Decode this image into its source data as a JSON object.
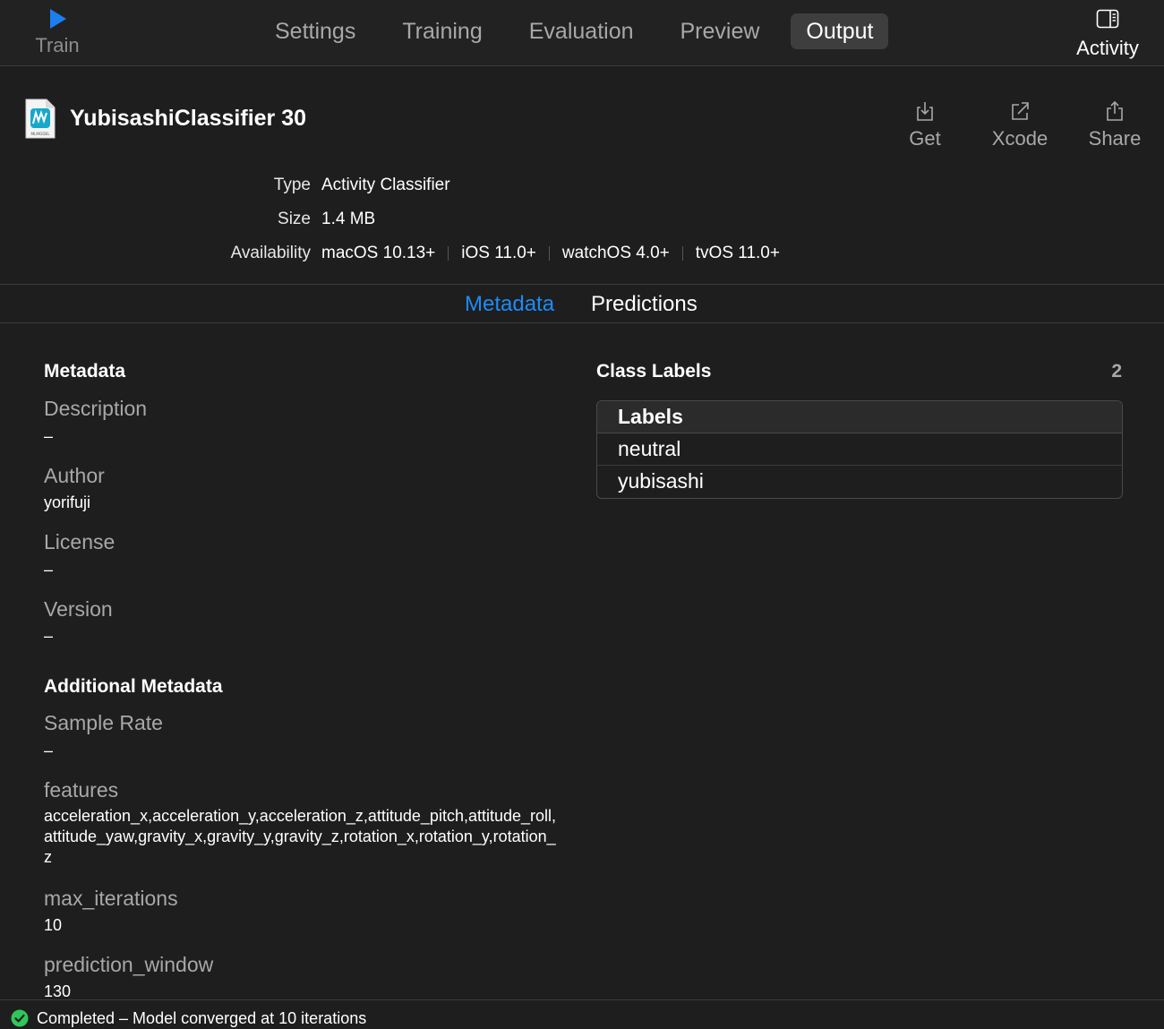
{
  "toolbar": {
    "train_label": "Train",
    "tabs": [
      {
        "label": "Settings"
      },
      {
        "label": "Training"
      },
      {
        "label": "Evaluation"
      },
      {
        "label": "Preview"
      },
      {
        "label": "Output"
      }
    ],
    "active_tab": "Output",
    "activity_label": "Activity"
  },
  "model": {
    "title": "YubisashiClassifier 30",
    "icon_text": "MLMODEL",
    "actions": [
      {
        "label": "Get",
        "icon": "download-icon"
      },
      {
        "label": "Xcode",
        "icon": "open-external-icon"
      },
      {
        "label": "Share",
        "icon": "share-icon"
      }
    ]
  },
  "info": {
    "type_label": "Type",
    "type_value": "Activity Classifier",
    "size_label": "Size",
    "size_value": "1.4 MB",
    "availability_label": "Availability",
    "platforms": [
      "macOS 10.13+",
      "iOS 11.0+",
      "watchOS 4.0+",
      "tvOS 11.0+"
    ]
  },
  "segments": {
    "metadata": "Metadata",
    "predictions": "Predictions",
    "active": "Metadata"
  },
  "metadata": {
    "title": "Metadata",
    "description_label": "Description",
    "description_value": "–",
    "author_label": "Author",
    "author_value": "yorifuji",
    "license_label": "License",
    "license_value": "–",
    "version_label": "Version",
    "version_value": "–"
  },
  "additional_metadata": {
    "title": "Additional Metadata",
    "sample_rate_label": "Sample Rate",
    "sample_rate_value": "–",
    "features_label": "features",
    "features_value": "acceleration_x,acceleration_y,acceleration_z,attitude_pitch,attitude_roll,attitude_yaw,gravity_x,gravity_y,gravity_z,rotation_x,rotation_y,rotation_z",
    "max_iterations_label": "max_iterations",
    "max_iterations_value": "10",
    "prediction_window_label": "prediction_window",
    "prediction_window_value": "130"
  },
  "class_labels": {
    "title": "Class Labels",
    "count": "2",
    "header": "Labels",
    "items": [
      "neutral",
      "yubisashi"
    ]
  },
  "status": {
    "text": "Completed – Model converged at 10 iterations",
    "color": "#30c759"
  },
  "colors": {
    "accent": "#1c8cf8",
    "background": "#1e1e1e"
  }
}
